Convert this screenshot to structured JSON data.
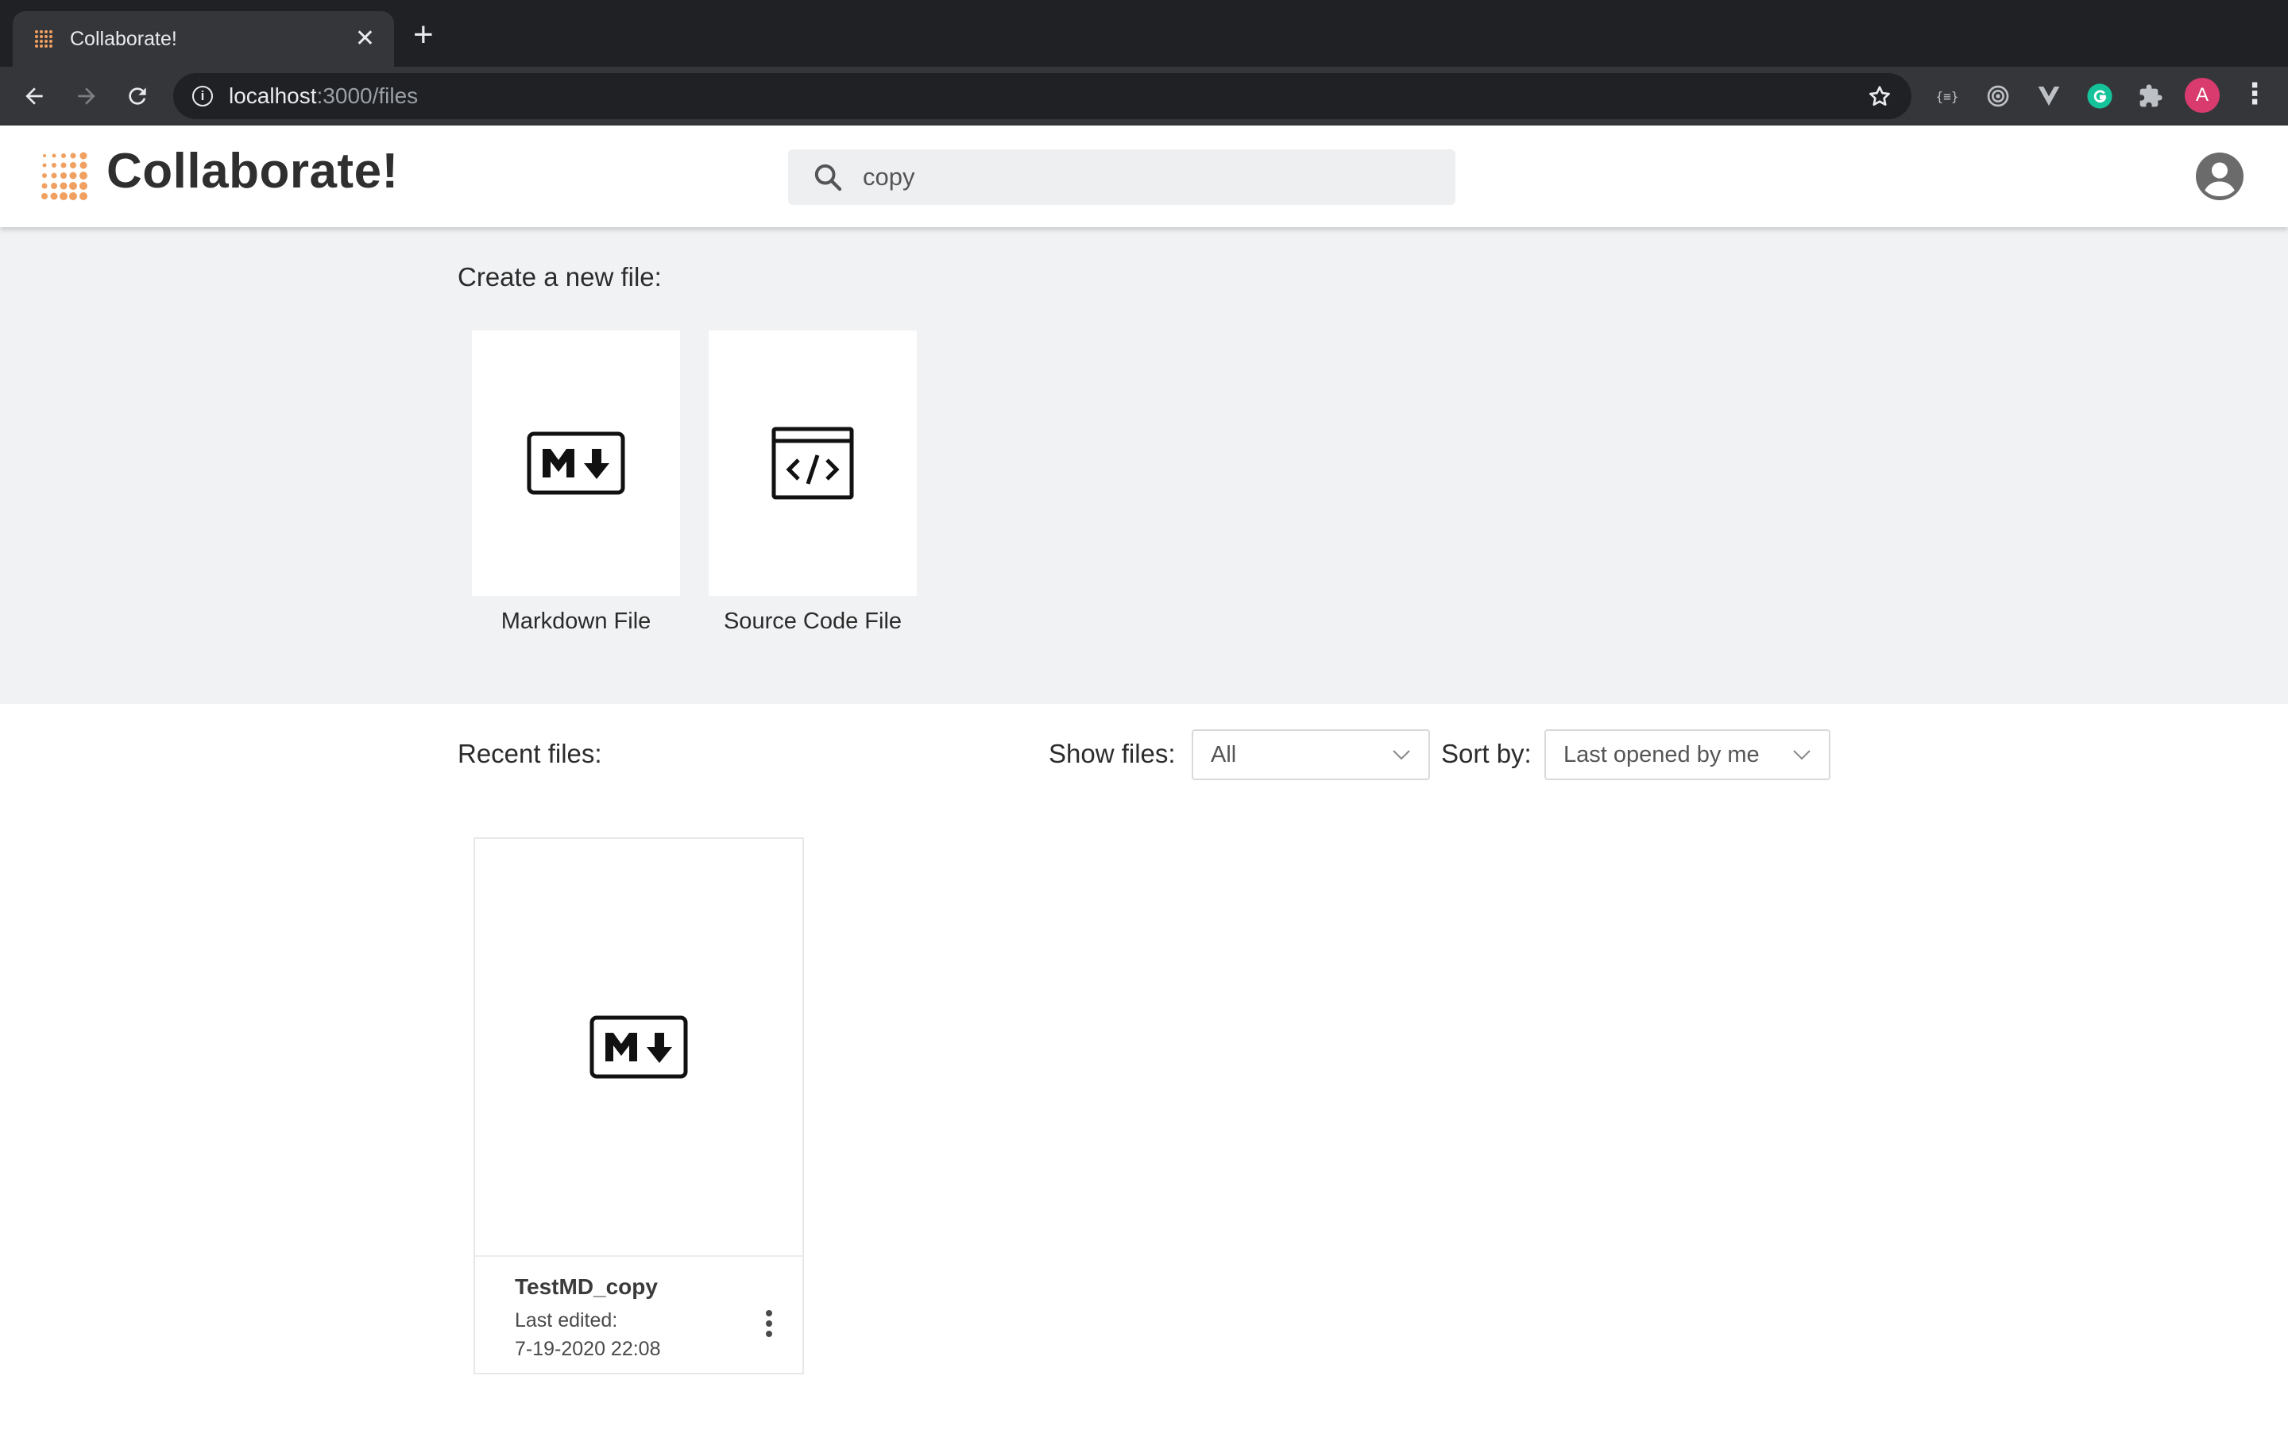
{
  "browser": {
    "tab_title": "Collaborate!",
    "tab_close": "✕",
    "new_tab": "+",
    "url_host": "localhost",
    "url_path": ":3000/files",
    "profile_initial": "A"
  },
  "header": {
    "brand": "Collaborate!",
    "search_value": "copy",
    "accent_color": "#f0a060"
  },
  "create": {
    "label": "Create a new file:",
    "templates": [
      {
        "label": "Markdown File",
        "icon": "markdown-icon"
      },
      {
        "label": "Source Code File",
        "icon": "source-code-icon"
      }
    ]
  },
  "recent": {
    "label": "Recent files:",
    "show_files_label": "Show files:",
    "show_files_value": "All",
    "sort_by_label": "Sort by:",
    "sort_by_value": "Last opened by me",
    "files": [
      {
        "name": "TestMD_copy",
        "last_edited_label": "Last edited:",
        "last_edited_value": "7-19-2020 22:08",
        "icon": "markdown-icon"
      }
    ]
  }
}
